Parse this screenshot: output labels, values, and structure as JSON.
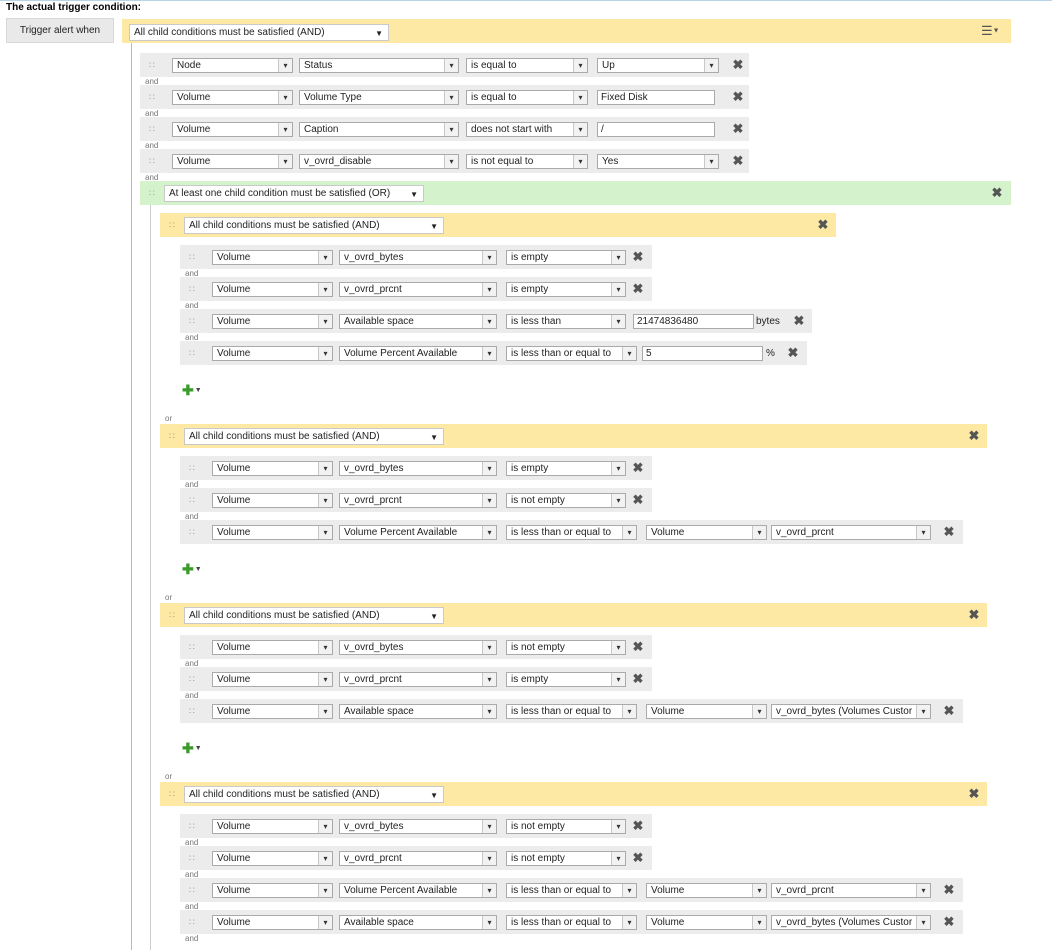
{
  "heading": "The actual trigger condition:",
  "trigger_label": "Trigger alert when",
  "root_group": "All child conditions must be satisfied (AND)",
  "and": "and",
  "or": "or",
  "top_conditions": [
    {
      "object": "Node",
      "field": "Status",
      "op": "is equal to",
      "value": "Up",
      "value_type": "select"
    },
    {
      "object": "Volume",
      "field": "Volume Type",
      "op": "is equal to",
      "value": "Fixed Disk",
      "value_type": "input"
    },
    {
      "object": "Volume",
      "field": "Caption",
      "op": "does not start with",
      "value": "/",
      "value_type": "input"
    },
    {
      "object": "Volume",
      "field": "v_ovrd_disable",
      "op": "is not equal to",
      "value": "Yes",
      "value_type": "select"
    }
  ],
  "or_group": "At least one child condition must be satisfied (OR)",
  "subgroups": [
    {
      "label": "All child conditions must be satisfied (AND)",
      "conditions": [
        {
          "object": "Volume",
          "field": "v_ovrd_bytes",
          "op": "is empty"
        },
        {
          "object": "Volume",
          "field": "v_ovrd_prcnt",
          "op": "is empty"
        },
        {
          "object": "Volume",
          "field": "Available space",
          "op": "is less than",
          "value": "21474836480",
          "unit": "bytes"
        },
        {
          "object": "Volume",
          "field": "Volume Percent Available",
          "op": "is less than or equal to",
          "value": "5",
          "unit": "%"
        }
      ]
    },
    {
      "label": "All child conditions must be satisfied (AND)",
      "conditions": [
        {
          "object": "Volume",
          "field": "v_ovrd_bytes",
          "op": "is empty"
        },
        {
          "object": "Volume",
          "field": "v_ovrd_prcnt",
          "op": "is not empty"
        },
        {
          "object": "Volume",
          "field": "Volume Percent Available",
          "op": "is less than or equal to",
          "ref_object": "Volume",
          "ref_field": "v_ovrd_prcnt"
        }
      ]
    },
    {
      "label": "All child conditions must be satisfied (AND)",
      "conditions": [
        {
          "object": "Volume",
          "field": "v_ovrd_bytes",
          "op": "is not empty"
        },
        {
          "object": "Volume",
          "field": "v_ovrd_prcnt",
          "op": "is empty"
        },
        {
          "object": "Volume",
          "field": "Available space",
          "op": "is less than or equal to",
          "ref_object": "Volume",
          "ref_field": "v_ovrd_bytes (Volumes Custor"
        }
      ]
    },
    {
      "label": "All child conditions must be satisfied (AND)",
      "conditions": [
        {
          "object": "Volume",
          "field": "v_ovrd_bytes",
          "op": "is not empty"
        },
        {
          "object": "Volume",
          "field": "v_ovrd_prcnt",
          "op": "is not empty"
        },
        {
          "object": "Volume",
          "field": "Volume Percent Available",
          "op": "is less than or equal to",
          "ref_object": "Volume",
          "ref_field": "v_ovrd_prcnt"
        },
        {
          "object": "Volume",
          "field": "Available space",
          "op": "is less than or equal to",
          "ref_object": "Volume",
          "ref_field": "v_ovrd_bytes (Volumes Custor"
        }
      ]
    }
  ],
  "icons": {
    "handle": "drag-handle-icon",
    "remove": "remove-icon",
    "add": "add-condition-icon",
    "menu": "menu-icon"
  },
  "colors": {
    "and_group": "#fde9a3",
    "or_group": "#d4f3cd",
    "row_bg": "#ececec"
  }
}
